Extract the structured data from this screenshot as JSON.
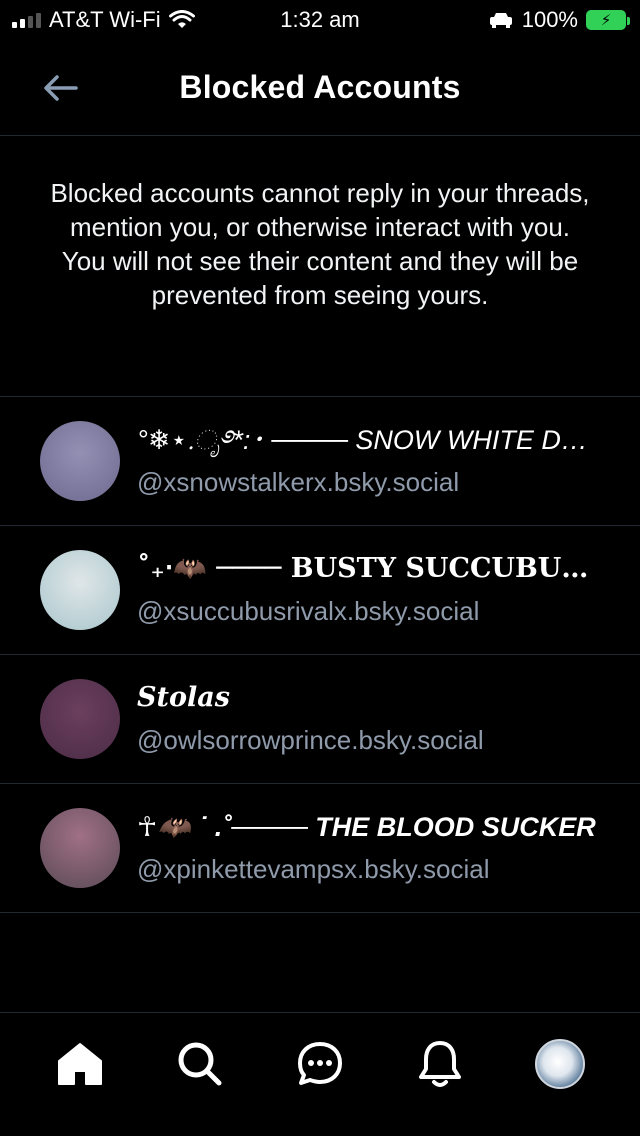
{
  "status_bar": {
    "carrier": "AT&T Wi-Fi",
    "time": "1:32 am",
    "battery": "100%"
  },
  "header": {
    "title": "Blocked Accounts",
    "back_icon": "arrow-left-icon"
  },
  "description": "Blocked accounts cannot reply in your threads, mention you, or otherwise interact with you. You will not see their content and they will be prevented from seeing yours.",
  "accounts": [
    {
      "display_name": "°❄︎⋆.ೃ࿔*:･ ──── SNOW WHITE DEAD",
      "handle": "@xsnowstalkerx.bsky.social",
      "avatar_colors": [
        "#6e6a8f",
        "#9490b4"
      ]
    },
    {
      "display_name": "˚₊‧🦇 ──── BUSTY SUCCUBUS RIVAL",
      "handle": "@xsuccubusrivalx.bsky.social",
      "avatar_colors": [
        "#a9c6cc",
        "#dfe6e8"
      ]
    },
    {
      "display_name": "Stolas",
      "handle": "@owlsorrowprince.bsky.social",
      "avatar_colors": [
        "#4b2c45",
        "#6b3f5f"
      ]
    },
    {
      "display_name": "☥🦇 ˙ .˚──── THE BLOOD SUCKER",
      "handle": "@xpinkettevampsx.bsky.social",
      "avatar_colors": [
        "#8c5d74",
        "#5a4a55"
      ]
    }
  ],
  "nav": {
    "items": [
      "home-icon",
      "search-icon",
      "chat-icon",
      "bell-icon",
      "profile-avatar"
    ]
  }
}
